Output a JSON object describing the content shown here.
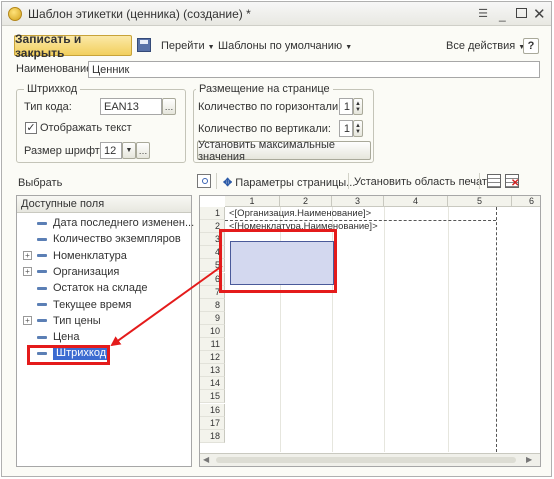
{
  "window": {
    "title": "Шаблон этикетки (ценника) (создание) *",
    "controls": [
      "menu-icon",
      "minimize-icon",
      "maximize-icon",
      "close-icon"
    ]
  },
  "toolbar": {
    "save_close": "Записать и закрыть",
    "goto": "Перейти",
    "templates": "Шаблоны по умолчанию",
    "all_actions": "Все действия"
  },
  "name": {
    "label": "Наименование:",
    "value": "Ценник"
  },
  "barcode_group": {
    "title": "Штрихкод",
    "code_type_label": "Тип кода:",
    "code_type_value": "EAN13",
    "show_text_label": "Отображать текст",
    "show_text_checked": true,
    "font_size_label": "Размер шрифта:",
    "font_size_value": "12"
  },
  "placement_group": {
    "title": "Размещение на странице",
    "horizontal_label": "Количество по горизонтали:",
    "horizontal_value": "1",
    "vertical_label": "Количество по вертикали:",
    "vertical_value": "1",
    "max_button": "Установить максимальные значения"
  },
  "left_panel": {
    "choose_label": "Выбрать",
    "header": "Доступные поля",
    "fields": [
      {
        "label": "Дата последнего изменен...",
        "expandable": false
      },
      {
        "label": "Количество экземпляров",
        "expandable": false
      },
      {
        "label": "Номенклатура",
        "expandable": true
      },
      {
        "label": "Организация",
        "expandable": true
      },
      {
        "label": "Остаток на складе",
        "expandable": false
      },
      {
        "label": "Текущее время",
        "expandable": false
      },
      {
        "label": "Тип цены",
        "expandable": true
      },
      {
        "label": "Цена",
        "expandable": false
      },
      {
        "label": "Штрихкод",
        "expandable": false,
        "selected": true
      }
    ]
  },
  "sheet_toolbar": {
    "page_params": "Параметры страницы...",
    "print_area": "Установить область печати"
  },
  "sheet": {
    "columns": [
      "1",
      "2",
      "3",
      "4",
      "5",
      "6"
    ],
    "rows": [
      "1",
      "2",
      "3",
      "4",
      "5",
      "6",
      "7",
      "8",
      "9",
      "10",
      "11",
      "12",
      "13",
      "14",
      "15",
      "16",
      "17",
      "18"
    ],
    "cell_r1": "<[Организация.Наименование]>",
    "cell_r2": "<[Номенклатура.Наименование]>"
  },
  "colors": {
    "accent_yellow": "#f5d86b",
    "highlight_red": "#e41b1b",
    "selection_blue": "#d3d8ef",
    "selected_item_bg": "#3c6bd1"
  }
}
